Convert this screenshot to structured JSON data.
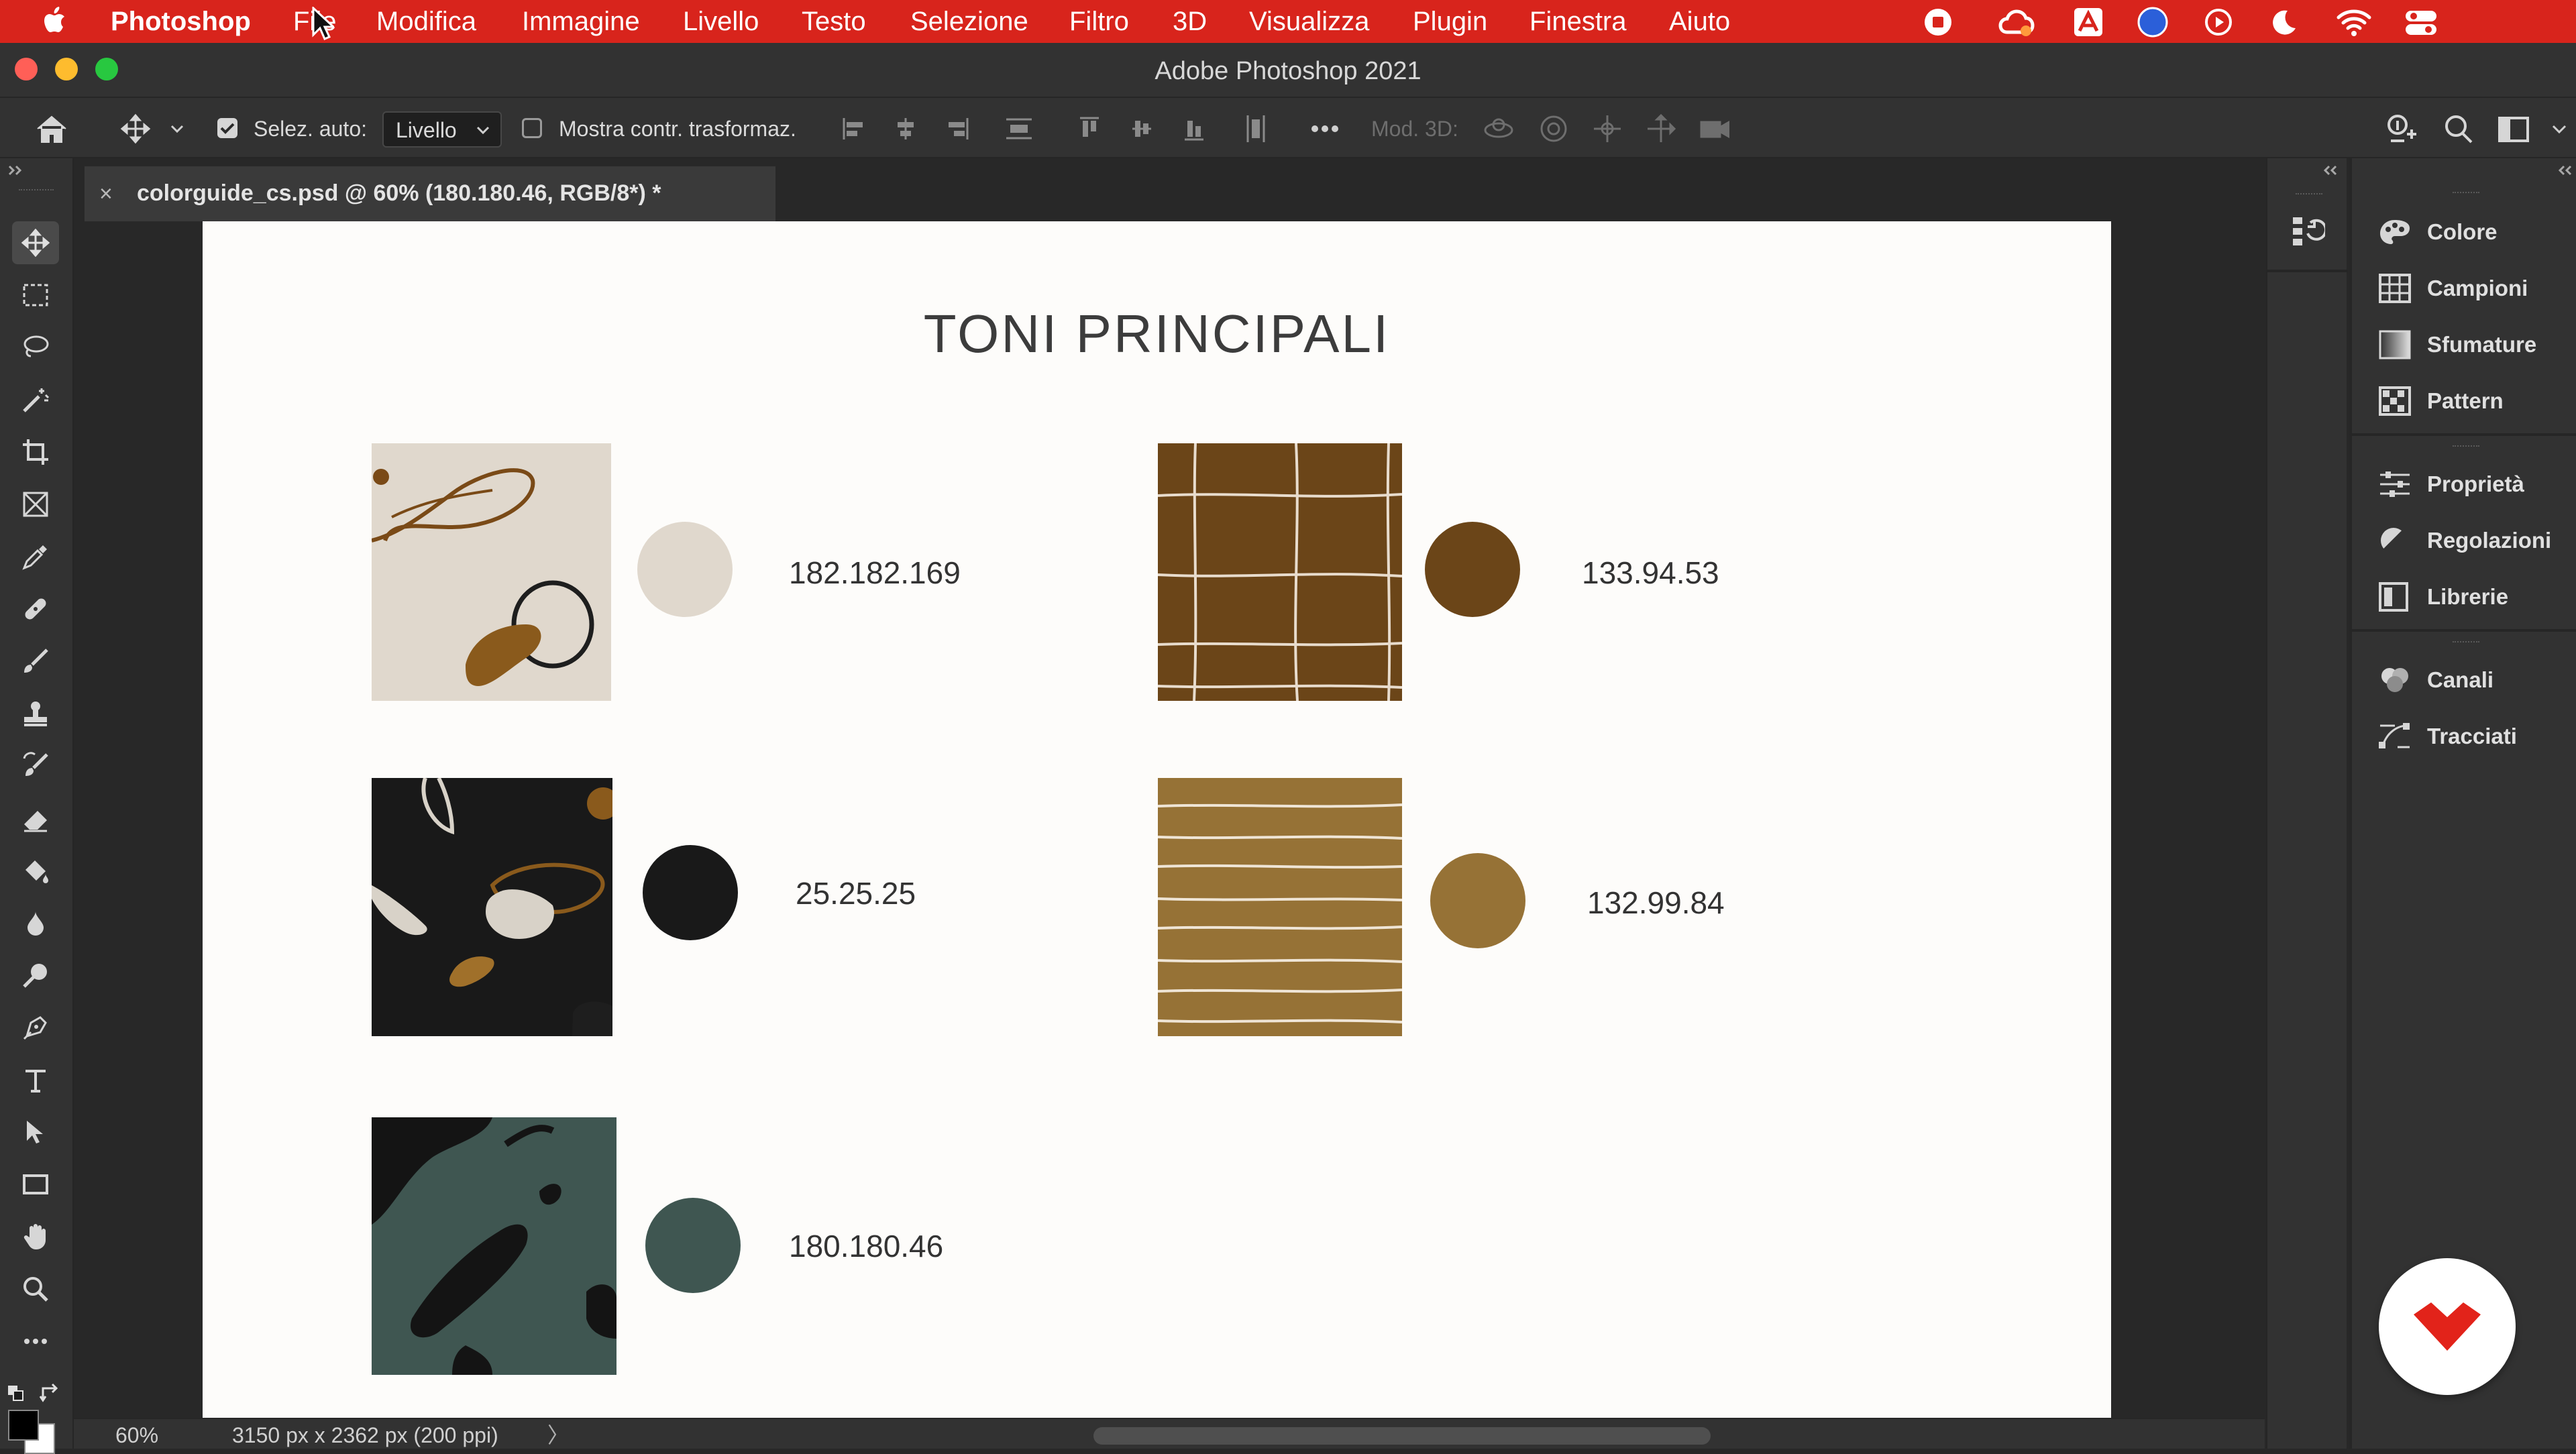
{
  "menubar": {
    "app_name": "Photoshop",
    "items": [
      "File",
      "Modifica",
      "Immagine",
      "Livello",
      "Testo",
      "Selezione",
      "Filtro",
      "3D",
      "Visualizza",
      "Plugin",
      "Finestra",
      "Aiuto"
    ],
    "icons": [
      "apple-icon",
      "record-icon",
      "creative-cloud-icon",
      "adobe-acrobat-icon",
      "siri-icon",
      "play-icon",
      "moon-icon",
      "wifi-icon",
      "control-center-icon"
    ],
    "colors": {
      "background": "#d8241c",
      "text": "#ffffff"
    }
  },
  "window": {
    "title": "Adobe Photoshop 2021",
    "traffic_lights": {
      "close": "#ff5f57",
      "minimize": "#febc2e",
      "zoom": "#28c840"
    }
  },
  "options_bar": {
    "auto_select_label": "Selez. auto:",
    "auto_select_checked": true,
    "layer_select_value": "Livello",
    "show_transform_label": "Mostra contr. trasformaz.",
    "show_transform_checked": false,
    "mode_3d_label": "Mod. 3D:",
    "icons": [
      "home-icon",
      "move-tool-icon",
      "align-left-icon",
      "align-center-h-icon",
      "align-right-icon",
      "distribute-h-icon",
      "align-top-icon",
      "align-middle-v-icon",
      "align-bottom-icon",
      "distribute-v-icon",
      "more-icon",
      "orbit-3d-icon",
      "roll-3d-icon",
      "pan-3d-icon",
      "slide-3d-icon",
      "scale-3d-icon",
      "share-icon",
      "search-icon",
      "workspace-icon"
    ]
  },
  "tools": [
    "move-tool",
    "rectangular-marquee-tool",
    "lasso-tool",
    "magic-wand-tool",
    "crop-tool",
    "frame-tool",
    "eyedropper-tool",
    "healing-brush-tool",
    "brush-tool",
    "clone-stamp-tool",
    "history-brush-tool",
    "eraser-tool",
    "paint-bucket-tool",
    "blur-tool",
    "dodge-tool",
    "pen-tool",
    "type-tool",
    "path-selection-tool",
    "rectangle-tool",
    "hand-tool",
    "zoom-tool",
    "edit-toolbar"
  ],
  "document": {
    "tab_close": "×",
    "tab_title": "colorguide_cs.psd @ 60% (180.180.46, RGB/8*) *",
    "heading": "TONI PRINCIPALI",
    "swatches": [
      {
        "code": "182.182.169",
        "color": "#e0d8cd",
        "pattern": "beige-organic-lines"
      },
      {
        "code": "133.94.53",
        "color": "#6b4518",
        "pattern": "brown-grid"
      },
      {
        "code": "25.25.25",
        "color": "#191919",
        "pattern": "black-organic-shapes"
      },
      {
        "code": "132.99.84",
        "color": "#967236",
        "pattern": "ochre-stripes"
      },
      {
        "code": "180.180.46",
        "color": "#3f5651",
        "pattern": "green-black-strokes"
      }
    ]
  },
  "status_bar": {
    "zoom": "60%",
    "doc_size": "3150 px x 2362 px (200 ppi)",
    "more_arrow": "〉"
  },
  "panels": {
    "group1": [
      {
        "label": "Colore",
        "icon": "palette-icon"
      },
      {
        "label": "Campioni",
        "icon": "swatches-grid-icon"
      },
      {
        "label": "Sfumature",
        "icon": "gradient-icon"
      },
      {
        "label": "Pattern",
        "icon": "pattern-icon"
      }
    ],
    "group2": [
      {
        "label": "Proprietà",
        "icon": "sliders-icon"
      },
      {
        "label": "Regolazioni",
        "icon": "adjustments-icon"
      },
      {
        "label": "Librerie",
        "icon": "libraries-icon"
      }
    ],
    "group3": [
      {
        "label": "Canali",
        "icon": "channels-icon"
      },
      {
        "label": "Tracciati",
        "icon": "paths-icon"
      }
    ]
  },
  "overlay_logo": {
    "icon": "domestika-logo-icon",
    "color": "#e2231a"
  }
}
